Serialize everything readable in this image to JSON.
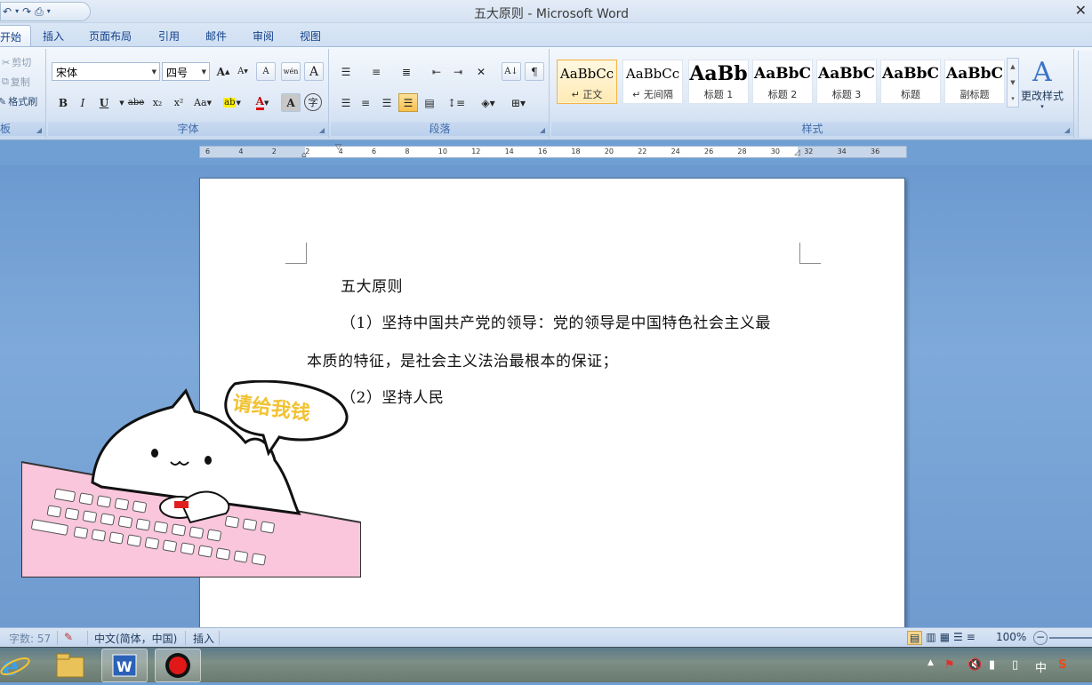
{
  "window": {
    "title": "五大原则 - Microsoft Word"
  },
  "qat": {
    "undo": "↶",
    "redo": "↷",
    "print": "⎙",
    "more": "▾"
  },
  "tabs": [
    "开始",
    "插入",
    "页面布局",
    "引用",
    "邮件",
    "审阅",
    "视图"
  ],
  "clipboard": {
    "cut": "剪切",
    "copy": "复制",
    "format_painter": "格式刷",
    "label": "板"
  },
  "font": {
    "name": "宋体",
    "size": "四号",
    "label": "字体",
    "grow": "A",
    "shrink": "A",
    "clear": "A",
    "phonetic": "wén",
    "border_char": "A",
    "bold": "B",
    "italic": "I",
    "underline": "U",
    "strike": "abe",
    "subscript": "x₂",
    "superscript": "x²",
    "change_case": "Aa",
    "highlight": "ab",
    "font_color": "A",
    "shading": "A",
    "enclose": "字"
  },
  "paragraph": {
    "label": "段落"
  },
  "styles": {
    "label": "样式",
    "items": [
      {
        "sample": "AaBbCc",
        "name": "↵ 正文"
      },
      {
        "sample": "AaBbCc",
        "name": "↵ 无间隔"
      },
      {
        "sample": "AaBb",
        "name": "标题 1"
      },
      {
        "sample": "AaBbC",
        "name": "标题 2"
      },
      {
        "sample": "AaBbC",
        "name": "标题 3"
      },
      {
        "sample": "AaBbC",
        "name": "标题"
      },
      {
        "sample": "AaBbC",
        "name": "副标题"
      }
    ],
    "change_styles": "更改样式"
  },
  "ruler": {
    "ticks": [
      "6",
      "4",
      "2",
      "2",
      "4",
      "6",
      "8",
      "10",
      "12",
      "14",
      "16",
      "18",
      "20",
      "22",
      "24",
      "26",
      "28",
      "30",
      "32",
      "34",
      "36"
    ]
  },
  "document": {
    "heading": "五大原则",
    "line1": "（1）坚持中国共产党的领导：党的领导是中国特色社会主义最",
    "line2": "本质的特征，是社会主义法治最根本的保证；",
    "line3": "（2）坚持人民"
  },
  "overlay": {
    "speech": "请给我钱"
  },
  "status": {
    "word_count": "字数: 57",
    "language": "中文(简体，中国)",
    "mode": "插入",
    "zoom": "100%"
  },
  "taskbar": {
    "ime": "中"
  }
}
